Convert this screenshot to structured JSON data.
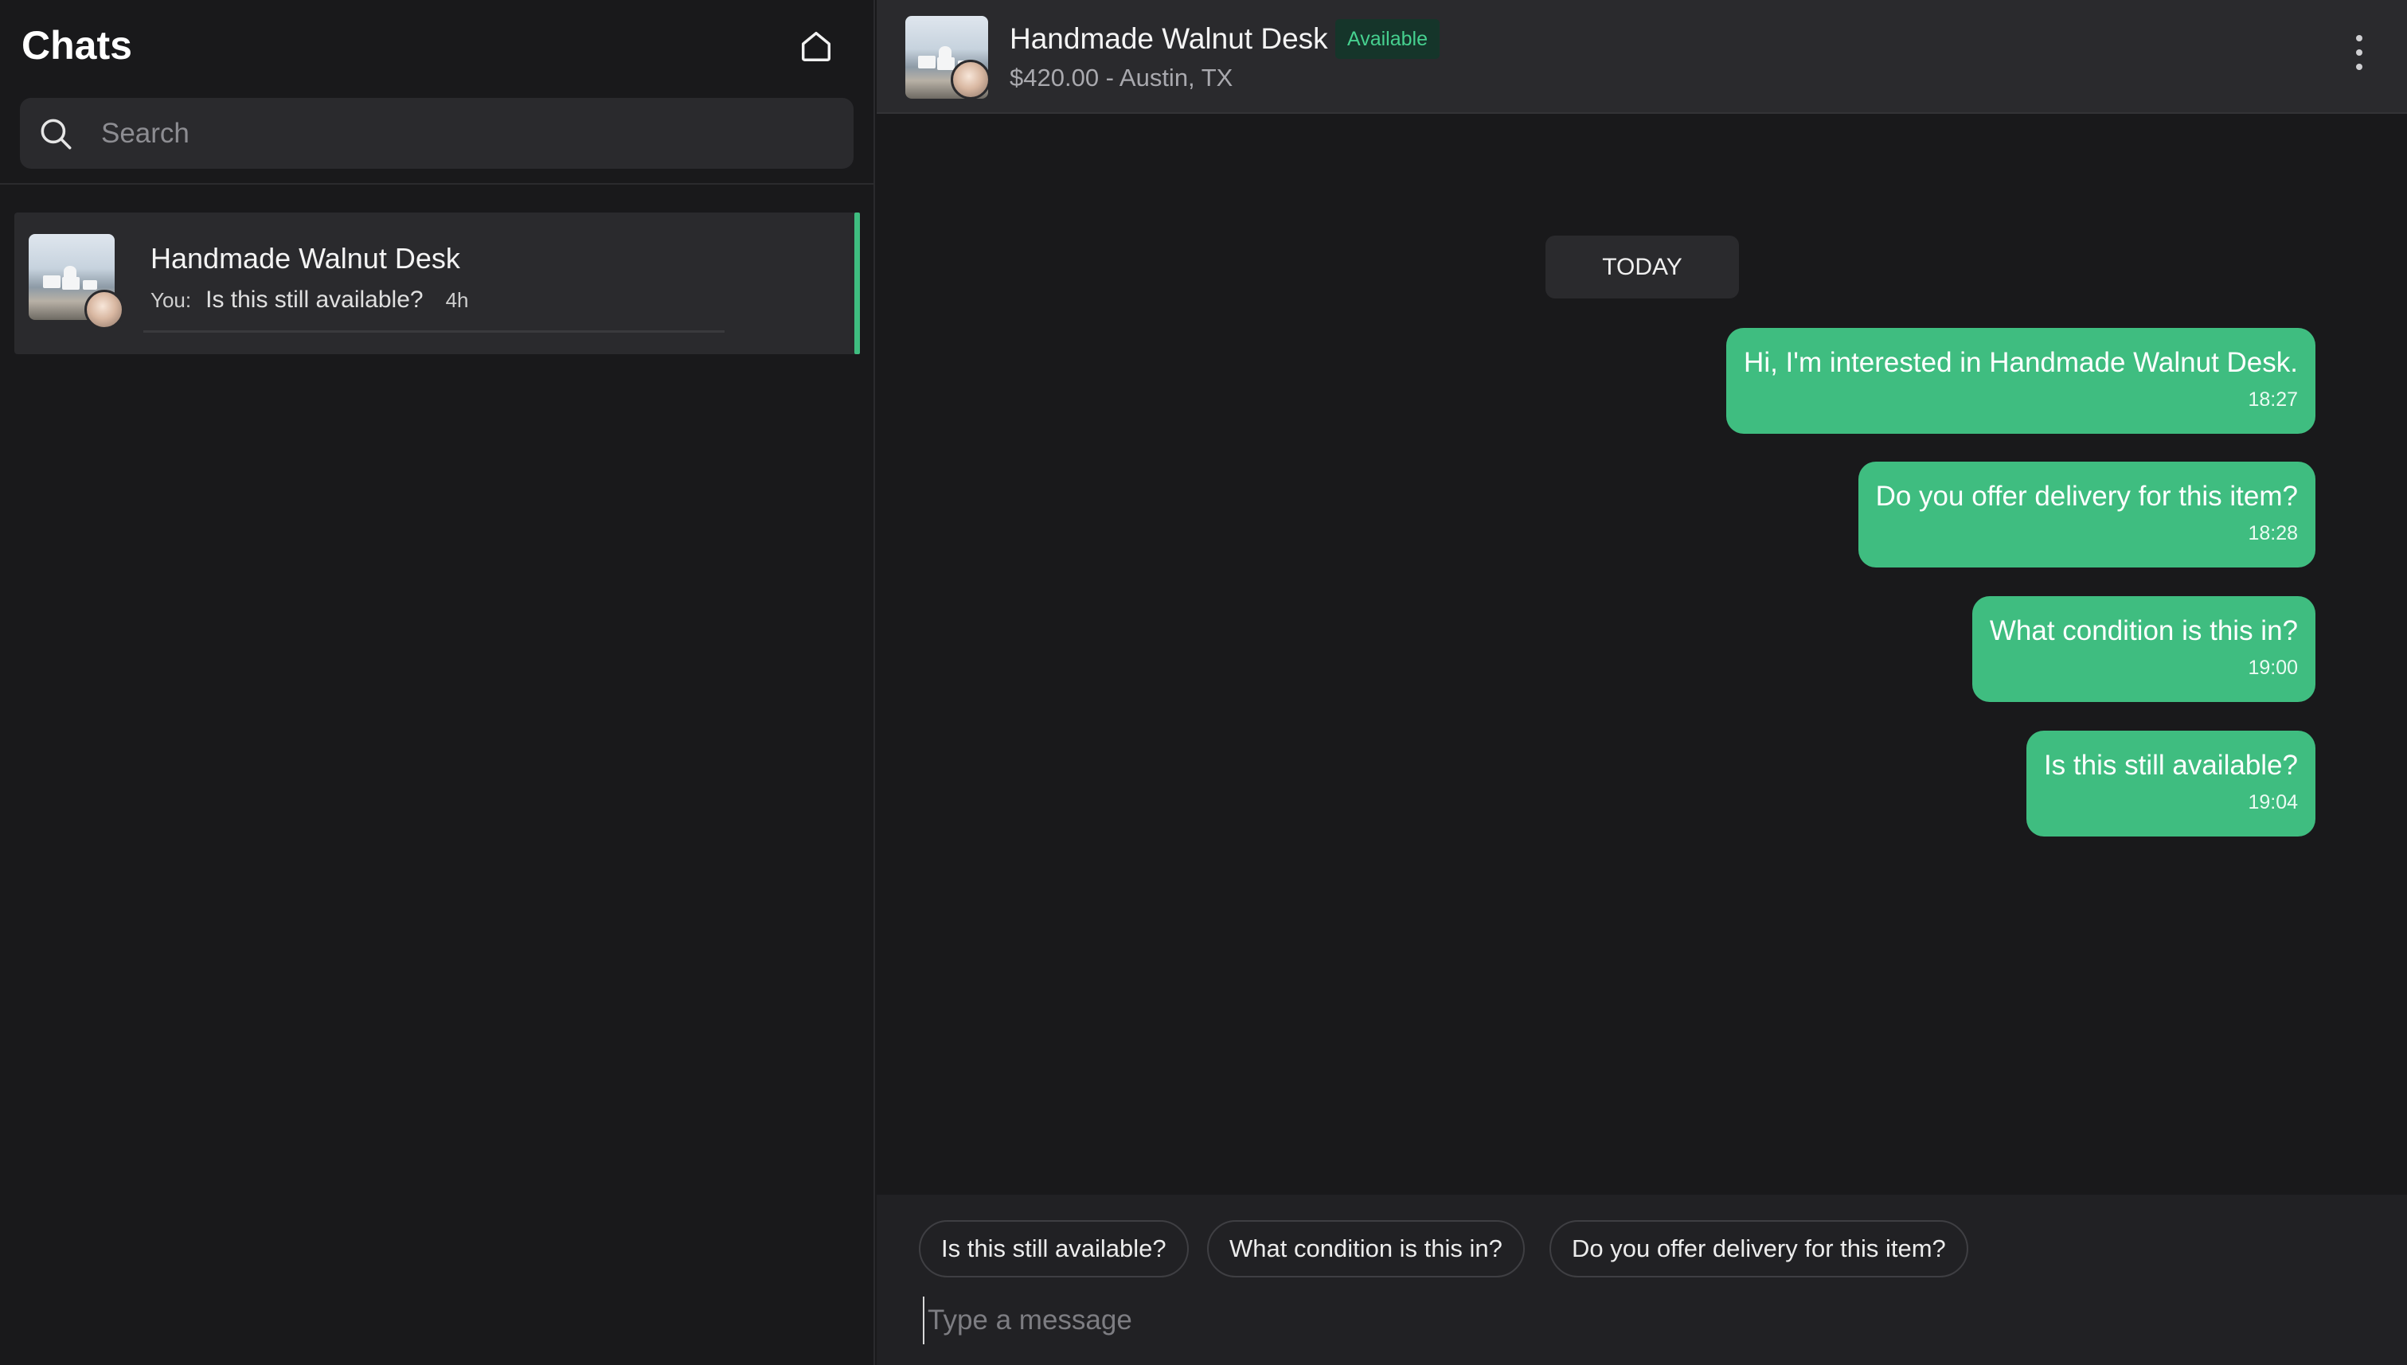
{
  "sidebar": {
    "title": "Chats",
    "search_placeholder": "Search",
    "conversations": [
      {
        "name": "Handmade Walnut Desk",
        "preview_prefix": "You:",
        "preview_text": "Is this still available?",
        "time": "4h"
      }
    ]
  },
  "header": {
    "title": "Handmade Walnut Desk",
    "status": "Available",
    "subtitle": "$420.00 - Austin, TX"
  },
  "messages": {
    "date_divider": "TODAY",
    "items": [
      {
        "text": "Hi, I'm interested in Handmade Walnut Desk.",
        "time": "18:27"
      },
      {
        "text": "Do you offer delivery for this item?",
        "time": "18:28"
      },
      {
        "text": "What condition is this in?",
        "time": "19:00"
      },
      {
        "text": "Is this still available?",
        "time": "19:04"
      }
    ]
  },
  "composer": {
    "quick_replies": [
      "Is this still available?",
      "What condition is this in?",
      "Do you offer delivery for this item?"
    ],
    "input_placeholder": "Type a message"
  },
  "colors": {
    "accent": "#3fbd80",
    "background": "#19191b",
    "panel": "#2a2a2d",
    "status_text": "#46d08f"
  },
  "icons": [
    "home-icon",
    "search-icon",
    "more-vertical-icon"
  ]
}
